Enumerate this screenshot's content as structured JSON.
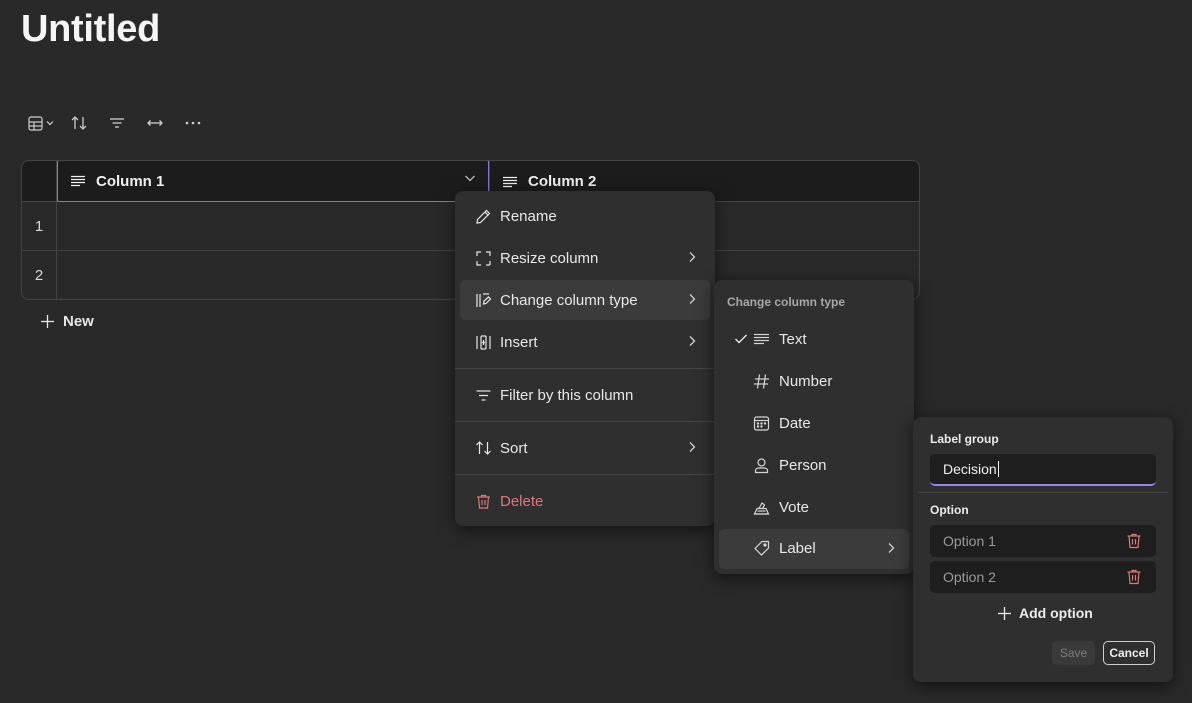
{
  "page": {
    "title": "Untitled"
  },
  "table": {
    "columns": [
      {
        "name": "Column 1",
        "type_icon": "text-lines-icon"
      },
      {
        "name": "Column 2",
        "type_icon": "text-lines-icon"
      }
    ],
    "rows": [
      {
        "number": "1"
      },
      {
        "number": "2"
      }
    ],
    "new_row_label": "New"
  },
  "toolbar": {
    "icons": [
      "table-view-icon",
      "chevron-down-icon",
      "sort-icon",
      "filter-icon",
      "column-width-icon",
      "more-icon"
    ]
  },
  "column_menu": {
    "items": [
      {
        "label": "Rename",
        "icon": "pencil-icon",
        "submenu": false
      },
      {
        "label": "Resize column",
        "icon": "resize-icon",
        "submenu": true
      },
      {
        "label": "Change column type",
        "icon": "change-type-icon",
        "submenu": true,
        "highlighted": true
      },
      {
        "label": "Insert",
        "icon": "insert-column-icon",
        "submenu": true
      },
      {
        "label": "Filter by this column",
        "icon": "filter-icon",
        "submenu": false
      },
      {
        "label": "Sort",
        "icon": "sort-icon",
        "submenu": true
      },
      {
        "label": "Delete",
        "icon": "trash-icon",
        "submenu": false,
        "color": "#e0787f"
      }
    ]
  },
  "type_menu": {
    "header": "Change column type",
    "items": [
      {
        "label": "Text",
        "icon": "text-lines-icon",
        "checked": true
      },
      {
        "label": "Number",
        "icon": "hash-icon",
        "checked": false
      },
      {
        "label": "Date",
        "icon": "calendar-icon",
        "checked": false
      },
      {
        "label": "Person",
        "icon": "person-icon",
        "checked": false
      },
      {
        "label": "Vote",
        "icon": "vote-icon",
        "checked": false
      },
      {
        "label": "Label",
        "icon": "tag-icon",
        "checked": false,
        "submenu": true,
        "highlighted": true
      }
    ]
  },
  "label_panel": {
    "group_header": "Label group",
    "group_value": "Decision",
    "option_header": "Option",
    "options": [
      {
        "placeholder": "Option 1"
      },
      {
        "placeholder": "Option 2"
      }
    ],
    "add_option_label": "Add option",
    "save_label": "Save",
    "cancel_label": "Cancel"
  },
  "colors": {
    "background": "#292929",
    "accent": "#8b74d6",
    "danger": "#e0787f",
    "menu_background": "#2f2f2f"
  }
}
